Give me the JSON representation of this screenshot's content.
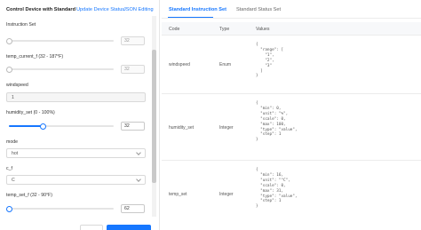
{
  "left_panel": {
    "title": "Control Device with Standard",
    "tabs": [
      "Update Device Status",
      "JSON Editing"
    ],
    "section_label": "Instruction Set",
    "fields": [
      {
        "label": "",
        "type": "slider",
        "value": "32",
        "progress": 0.0,
        "enabled": false
      },
      {
        "label": "temp_current_f (32 - 187°F)",
        "type": "slider",
        "value": "32",
        "progress": 0.0,
        "enabled": false
      },
      {
        "label": "windspeed",
        "type": "select",
        "value": "1",
        "enabled": false
      },
      {
        "label": "humidity_set (0 - 100%)",
        "type": "slider",
        "value": "32",
        "progress": 0.32,
        "enabled": true
      },
      {
        "label": "mode",
        "type": "select",
        "value": "hot",
        "enabled": true
      },
      {
        "label": "c_f",
        "type": "select",
        "value": "C",
        "enabled": true
      },
      {
        "label": "temp_set_f (32 - 90°F)",
        "type": "slider",
        "value": "62",
        "progress": 0.0,
        "enabled": true
      }
    ]
  },
  "right_panel": {
    "tabs": [
      "Standard Instruction Set",
      "Standard Status Set"
    ],
    "active_tab": 0,
    "columns": [
      "Code",
      "Type",
      "Values"
    ],
    "rows": [
      {
        "code": "windspeed",
        "type": "Enum",
        "values": "{\n  \"range\": [\n    \"1\",\n    \"2\",\n    \"3\"\n  ]\n}"
      },
      {
        "code": "humidity_set",
        "type": "Integer",
        "values": "{\n  \"min\": 0,\n  \"unit\": \"%\",\n  \"scale\": 0,\n  \"max\": 100,\n  \"type\": \"value\",\n  \"step\": 1\n}"
      },
      {
        "code": "temp_set",
        "type": "Integer",
        "values": "{\n  \"min\": 16,\n  \"unit\": \"°C\",\n  \"scale\": 0,\n  \"max\": 31,\n  \"type\": \"value\",\n  \"step\": 1\n}"
      }
    ]
  },
  "colors": {
    "accent": "#1677ff",
    "border": "#d9d9d9",
    "header_bg": "#f7f8fa"
  }
}
